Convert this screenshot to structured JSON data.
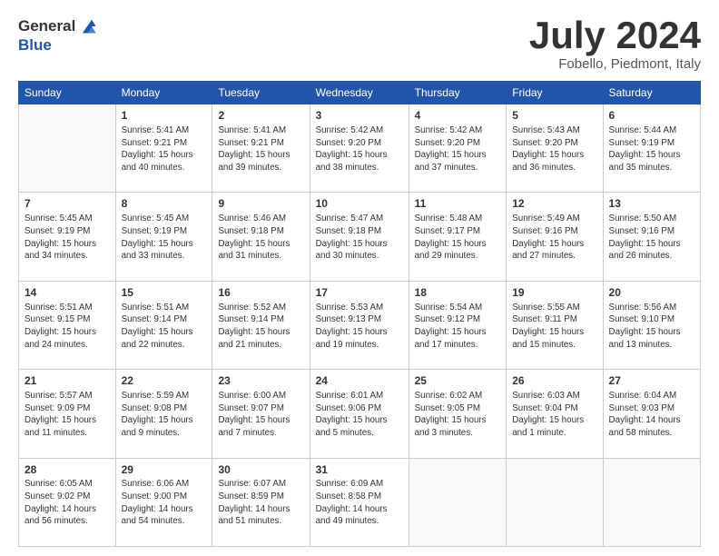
{
  "logo": {
    "general": "General",
    "blue": "Blue"
  },
  "header": {
    "month": "July 2024",
    "location": "Fobello, Piedmont, Italy"
  },
  "days_of_week": [
    "Sunday",
    "Monday",
    "Tuesday",
    "Wednesday",
    "Thursday",
    "Friday",
    "Saturday"
  ],
  "weeks": [
    [
      {
        "day": null,
        "text": null
      },
      {
        "day": "1",
        "text": "Sunrise: 5:41 AM\nSunset: 9:21 PM\nDaylight: 15 hours\nand 40 minutes."
      },
      {
        "day": "2",
        "text": "Sunrise: 5:41 AM\nSunset: 9:21 PM\nDaylight: 15 hours\nand 39 minutes."
      },
      {
        "day": "3",
        "text": "Sunrise: 5:42 AM\nSunset: 9:20 PM\nDaylight: 15 hours\nand 38 minutes."
      },
      {
        "day": "4",
        "text": "Sunrise: 5:42 AM\nSunset: 9:20 PM\nDaylight: 15 hours\nand 37 minutes."
      },
      {
        "day": "5",
        "text": "Sunrise: 5:43 AM\nSunset: 9:20 PM\nDaylight: 15 hours\nand 36 minutes."
      },
      {
        "day": "6",
        "text": "Sunrise: 5:44 AM\nSunset: 9:19 PM\nDaylight: 15 hours\nand 35 minutes."
      }
    ],
    [
      {
        "day": "7",
        "text": "Sunrise: 5:45 AM\nSunset: 9:19 PM\nDaylight: 15 hours\nand 34 minutes."
      },
      {
        "day": "8",
        "text": "Sunrise: 5:45 AM\nSunset: 9:19 PM\nDaylight: 15 hours\nand 33 minutes."
      },
      {
        "day": "9",
        "text": "Sunrise: 5:46 AM\nSunset: 9:18 PM\nDaylight: 15 hours\nand 31 minutes."
      },
      {
        "day": "10",
        "text": "Sunrise: 5:47 AM\nSunset: 9:18 PM\nDaylight: 15 hours\nand 30 minutes."
      },
      {
        "day": "11",
        "text": "Sunrise: 5:48 AM\nSunset: 9:17 PM\nDaylight: 15 hours\nand 29 minutes."
      },
      {
        "day": "12",
        "text": "Sunrise: 5:49 AM\nSunset: 9:16 PM\nDaylight: 15 hours\nand 27 minutes."
      },
      {
        "day": "13",
        "text": "Sunrise: 5:50 AM\nSunset: 9:16 PM\nDaylight: 15 hours\nand 26 minutes."
      }
    ],
    [
      {
        "day": "14",
        "text": "Sunrise: 5:51 AM\nSunset: 9:15 PM\nDaylight: 15 hours\nand 24 minutes."
      },
      {
        "day": "15",
        "text": "Sunrise: 5:51 AM\nSunset: 9:14 PM\nDaylight: 15 hours\nand 22 minutes."
      },
      {
        "day": "16",
        "text": "Sunrise: 5:52 AM\nSunset: 9:14 PM\nDaylight: 15 hours\nand 21 minutes."
      },
      {
        "day": "17",
        "text": "Sunrise: 5:53 AM\nSunset: 9:13 PM\nDaylight: 15 hours\nand 19 minutes."
      },
      {
        "day": "18",
        "text": "Sunrise: 5:54 AM\nSunset: 9:12 PM\nDaylight: 15 hours\nand 17 minutes."
      },
      {
        "day": "19",
        "text": "Sunrise: 5:55 AM\nSunset: 9:11 PM\nDaylight: 15 hours\nand 15 minutes."
      },
      {
        "day": "20",
        "text": "Sunrise: 5:56 AM\nSunset: 9:10 PM\nDaylight: 15 hours\nand 13 minutes."
      }
    ],
    [
      {
        "day": "21",
        "text": "Sunrise: 5:57 AM\nSunset: 9:09 PM\nDaylight: 15 hours\nand 11 minutes."
      },
      {
        "day": "22",
        "text": "Sunrise: 5:59 AM\nSunset: 9:08 PM\nDaylight: 15 hours\nand 9 minutes."
      },
      {
        "day": "23",
        "text": "Sunrise: 6:00 AM\nSunset: 9:07 PM\nDaylight: 15 hours\nand 7 minutes."
      },
      {
        "day": "24",
        "text": "Sunrise: 6:01 AM\nSunset: 9:06 PM\nDaylight: 15 hours\nand 5 minutes."
      },
      {
        "day": "25",
        "text": "Sunrise: 6:02 AM\nSunset: 9:05 PM\nDaylight: 15 hours\nand 3 minutes."
      },
      {
        "day": "26",
        "text": "Sunrise: 6:03 AM\nSunset: 9:04 PM\nDaylight: 15 hours\nand 1 minute."
      },
      {
        "day": "27",
        "text": "Sunrise: 6:04 AM\nSunset: 9:03 PM\nDaylight: 14 hours\nand 58 minutes."
      }
    ],
    [
      {
        "day": "28",
        "text": "Sunrise: 6:05 AM\nSunset: 9:02 PM\nDaylight: 14 hours\nand 56 minutes."
      },
      {
        "day": "29",
        "text": "Sunrise: 6:06 AM\nSunset: 9:00 PM\nDaylight: 14 hours\nand 54 minutes."
      },
      {
        "day": "30",
        "text": "Sunrise: 6:07 AM\nSunset: 8:59 PM\nDaylight: 14 hours\nand 51 minutes."
      },
      {
        "day": "31",
        "text": "Sunrise: 6:09 AM\nSunset: 8:58 PM\nDaylight: 14 hours\nand 49 minutes."
      },
      {
        "day": null,
        "text": null
      },
      {
        "day": null,
        "text": null
      },
      {
        "day": null,
        "text": null
      }
    ]
  ]
}
